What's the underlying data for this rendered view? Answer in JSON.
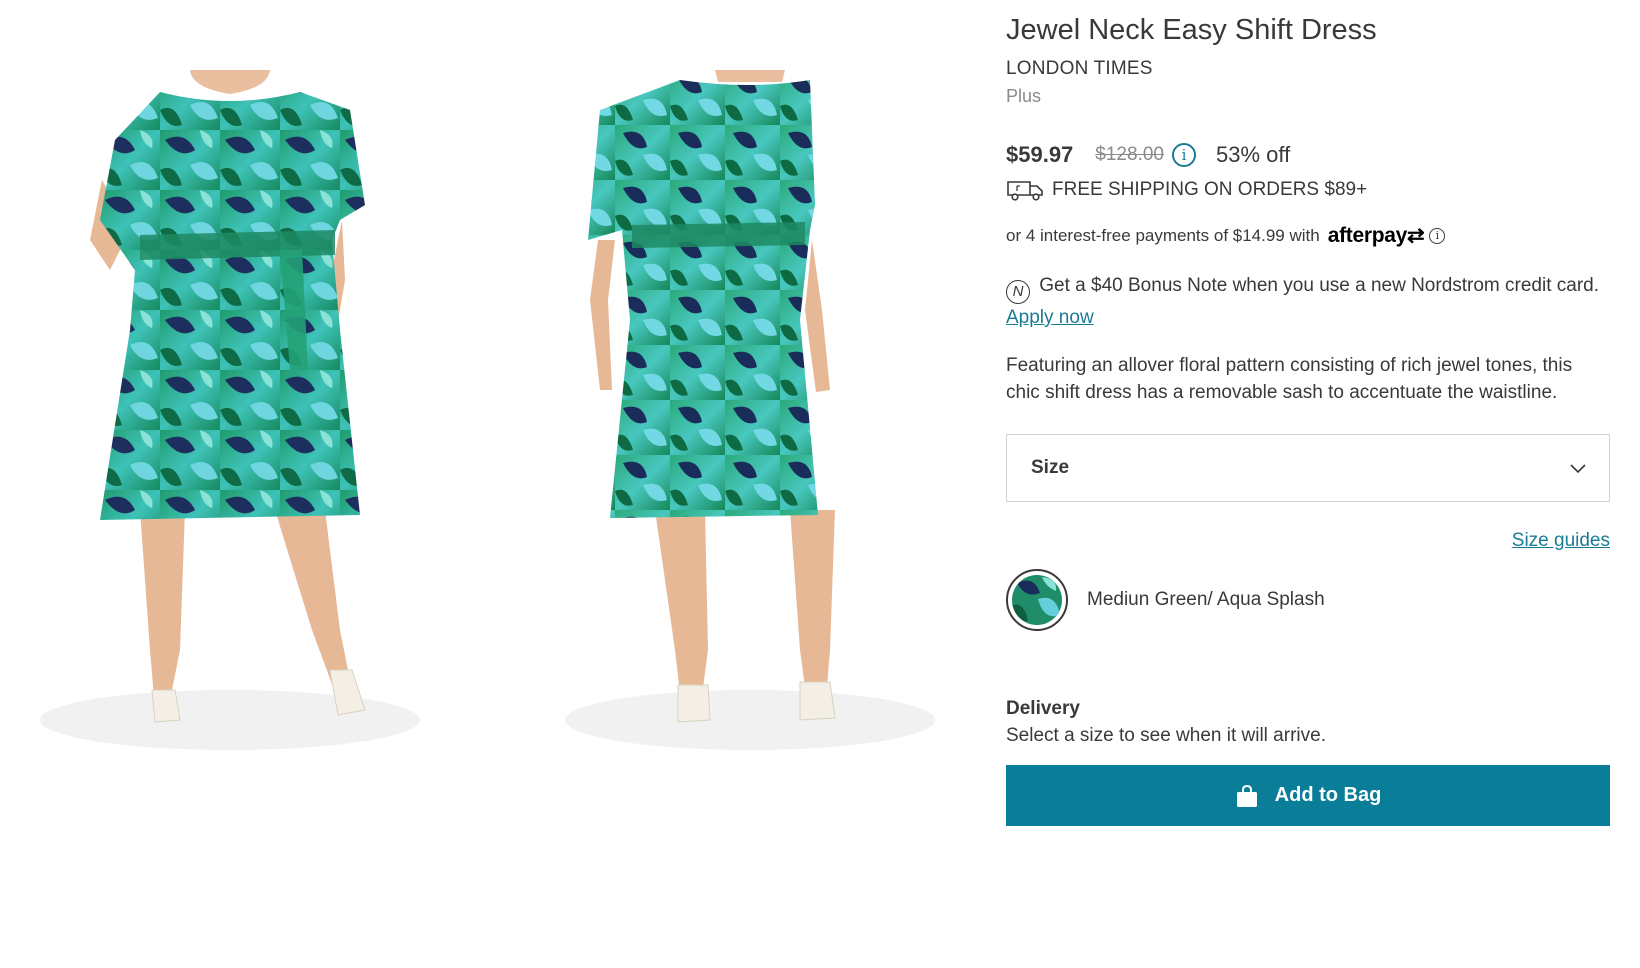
{
  "product": {
    "title": "Jewel Neck Easy Shift Dress",
    "brand": "LONDON TIMES",
    "fit": "Plus",
    "price_now": "$59.97",
    "price_was": "$128.00",
    "discount": "53% off",
    "info_glyph": "i"
  },
  "shipping": {
    "text": "FREE SHIPPING ON ORDERS $89+",
    "icon": "truck-icon"
  },
  "afterpay": {
    "text": "or 4 interest-free payments of $14.99 with",
    "logo": "afterpay",
    "logo_arrow": "⇄",
    "info_glyph": "i"
  },
  "bonus": {
    "icon_glyph": "N",
    "text": "Get a $40 Bonus Note when you use a new Nordstrom credit card.",
    "link": "Apply now"
  },
  "description": "Featuring an allover floral pattern consisting of rich jewel tones, this chic shift dress has a removable sash to accentuate the waistline.",
  "size_select": {
    "label": "Size",
    "icon": "chevron-down-icon"
  },
  "size_guides": "Size guides",
  "color": {
    "name": "Mediun Green/ Aqua Splash"
  },
  "delivery": {
    "title": "Delivery",
    "text": "Select a size to see when it will arrive."
  },
  "add_to_bag": {
    "label": "Add to Bag",
    "icon": "shopping-bag-icon"
  },
  "colors": {
    "accent": "#0a7e98",
    "link": "#1a7c93",
    "text": "#393939",
    "muted": "#8a8a8a"
  }
}
